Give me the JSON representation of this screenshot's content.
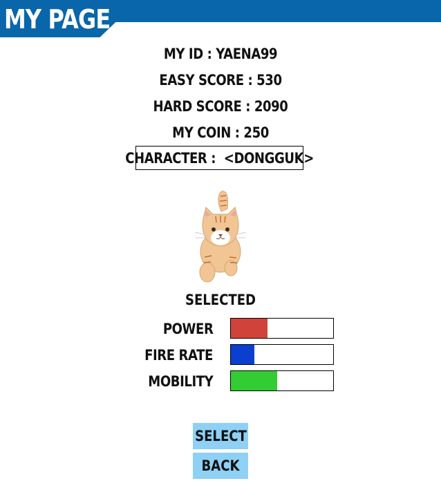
{
  "header": {
    "title": "MY PAGE"
  },
  "profile": {
    "id_line": "MY ID : YAENA99",
    "easy_line": "EASY SCORE : 530",
    "hard_line": "HARD SCORE : 2090",
    "coin_line": "MY COIN : 250",
    "character_line": "CHARACTER :  <DONGGUK>"
  },
  "character": {
    "image": "tabby-cat-character",
    "status": "SELECTED"
  },
  "stats": [
    {
      "label": "POWER",
      "value": 0.36,
      "color": "#d0433a"
    },
    {
      "label": "FIRE RATE",
      "value": 0.23,
      "color": "#0a3fd0"
    },
    {
      "label": "MOBILITY",
      "value": 0.45,
      "color": "#33cc33"
    }
  ],
  "buttons": {
    "select": "SELECT",
    "back": "BACK"
  },
  "colors": {
    "header": "#0a66aa",
    "button": "#8fd0f5"
  }
}
